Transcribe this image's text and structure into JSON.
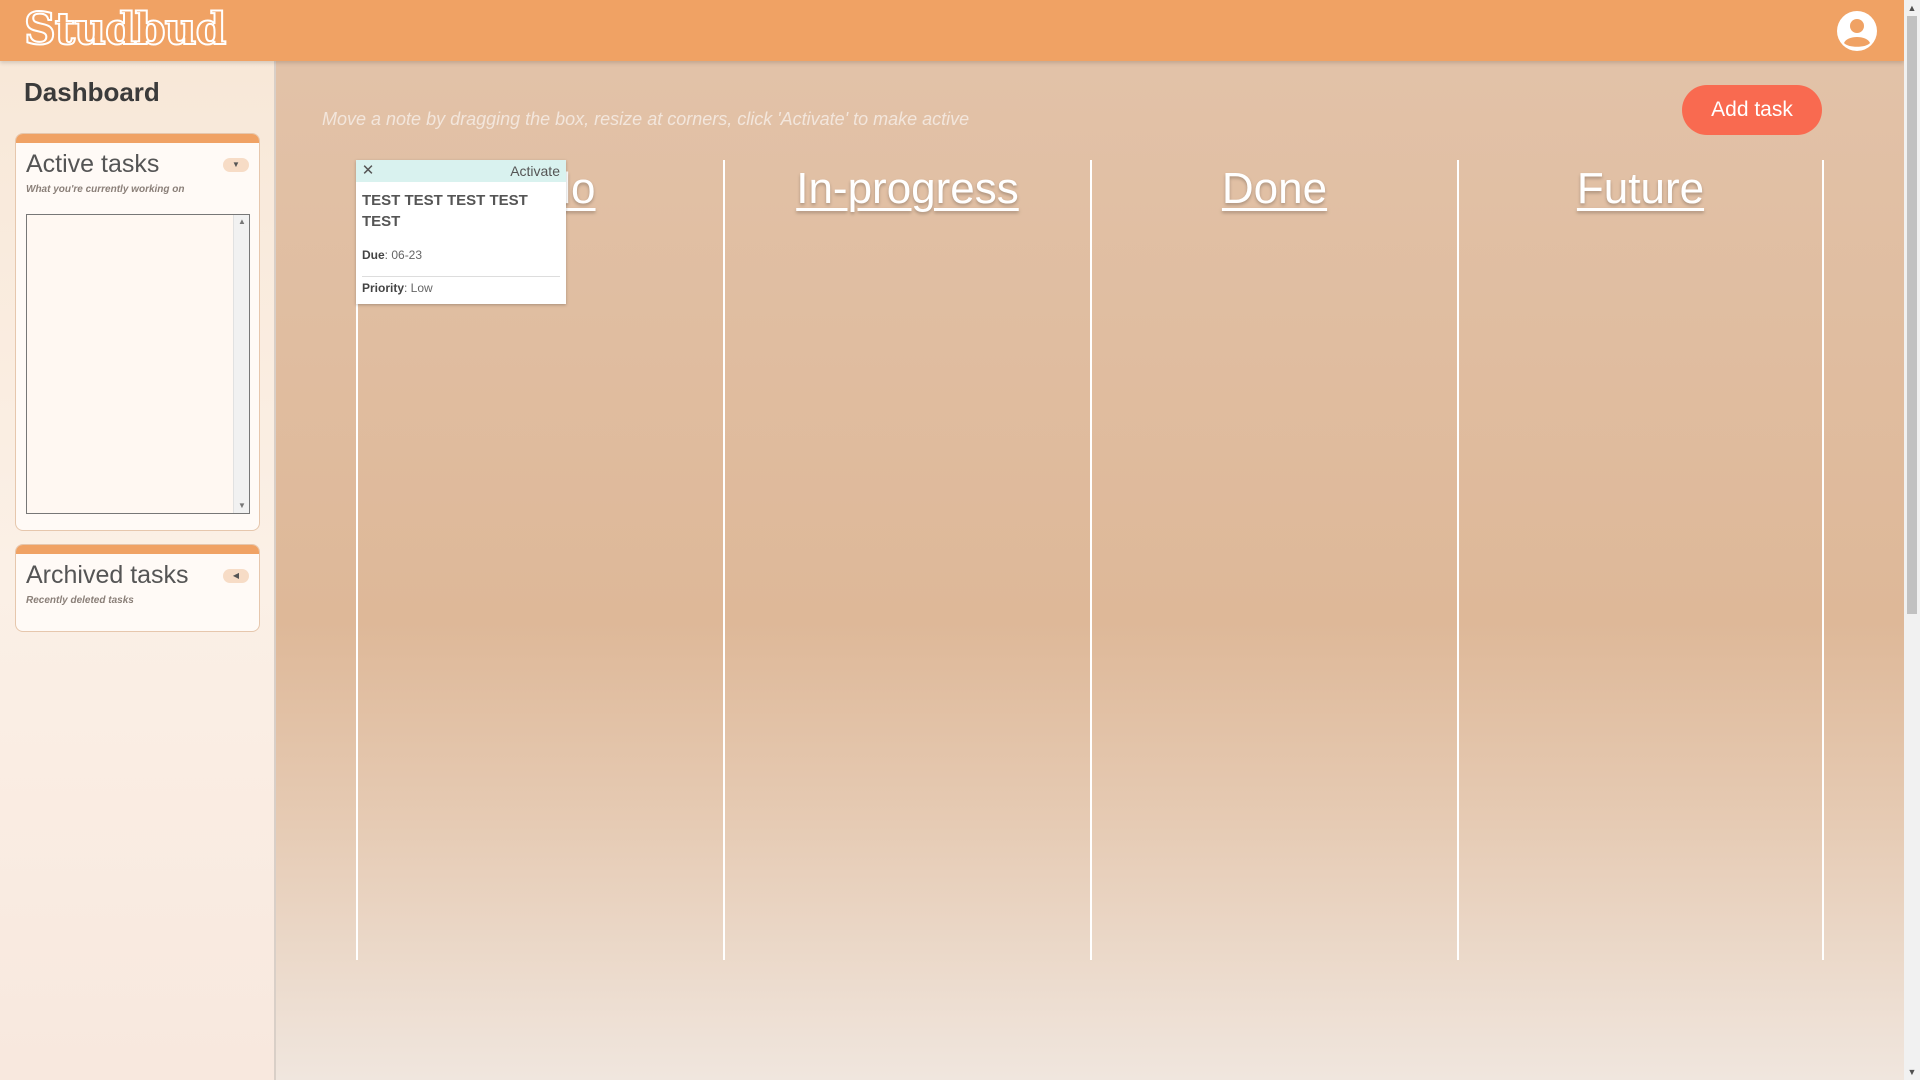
{
  "header": {
    "logo": "Studbud",
    "avatar_icon": "user-circle-icon"
  },
  "sidebar": {
    "title": "Dashboard",
    "active_panel": {
      "title": "Active tasks",
      "subtitle": "What you're currently working on",
      "toggle_icon": "triangle-down-icon",
      "toggle_glyph": "▼"
    },
    "archived_panel": {
      "title": "Archived tasks",
      "subtitle": "Recently deleted tasks",
      "toggle_icon": "triangle-left-icon",
      "toggle_glyph": "◀"
    }
  },
  "main": {
    "hint": "Move a note by dragging the box, resize at corners, click 'Activate' to make active",
    "add_task_label": "Add task",
    "columns": [
      {
        "title": "To-do"
      },
      {
        "title": "In-progress"
      },
      {
        "title": "Done"
      },
      {
        "title": "Future"
      }
    ]
  },
  "note": {
    "close_glyph": "✕",
    "activate_label": "Activate",
    "title": "TEST TEST TEST TEST TEST",
    "due_label": "Due",
    "due_value": ": 06-23",
    "priority_label": "Priority",
    "priority_value": ": Low"
  },
  "colors": {
    "header": "#f0a264",
    "accent_button": "#f96a50",
    "note_header": "#d9f2ef"
  }
}
